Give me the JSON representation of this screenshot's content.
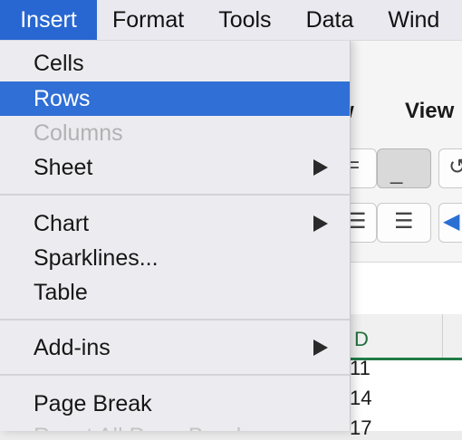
{
  "menubar": {
    "items": [
      "Insert",
      "Format",
      "Tools",
      "Data",
      "Wind"
    ]
  },
  "insert_menu": {
    "items": [
      {
        "label": "Cells",
        "submenu": false,
        "state": "normal"
      },
      {
        "label": "Rows",
        "submenu": false,
        "state": "highlighted"
      },
      {
        "label": "Columns",
        "submenu": false,
        "state": "disabled"
      },
      {
        "label": "Sheet",
        "submenu": true,
        "state": "normal"
      },
      {
        "label": "Chart",
        "submenu": true,
        "state": "normal"
      },
      {
        "label": "Sparklines...",
        "submenu": false,
        "state": "normal"
      },
      {
        "label": "Table",
        "submenu": false,
        "state": "normal"
      },
      {
        "label": "Add-ins",
        "submenu": true,
        "state": "normal"
      },
      {
        "label": "Page Break",
        "submenu": false,
        "state": "normal"
      },
      {
        "label": "Reset All Page Breaks",
        "submenu": false,
        "state": "faded"
      }
    ]
  },
  "ribbon": {
    "tab_partial": "w",
    "tab_view": "View"
  },
  "sheet": {
    "column_header": "D",
    "cells": [
      "11",
      "14",
      "17"
    ]
  },
  "colors": {
    "highlight": "#2f6fd6",
    "menubar_active": "#2867d1",
    "excel_green": "#1f7a45"
  }
}
